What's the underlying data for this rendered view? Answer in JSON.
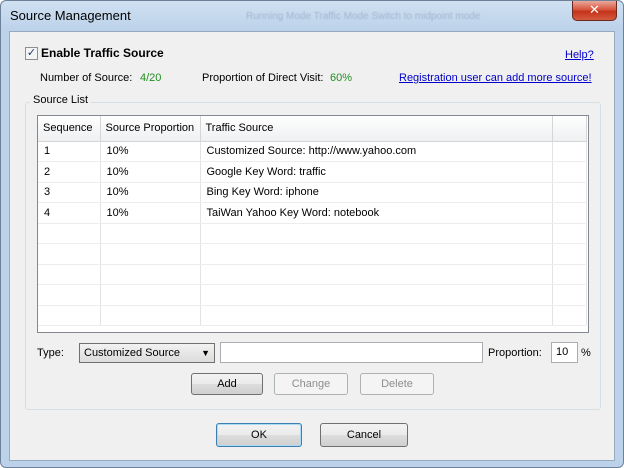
{
  "window": {
    "title": "Source Management",
    "ghost_title": "Running Mode    Traffic Mode    Switch to midpoint mode",
    "close_symbol": "✕"
  },
  "options": {
    "enable_checked_symbol": "✓",
    "enable_label": "Enable Traffic Source",
    "help_label": "Help?"
  },
  "stats": {
    "number_label": "Number of Source:",
    "number_value": "4/20",
    "proportion_label": "Proportion of Direct Visit:",
    "proportion_value": "60%",
    "register_link": "Registration user can add more source!"
  },
  "source_list": {
    "group_label": "Source List",
    "columns": [
      "Sequence",
      "Source Proportion",
      "Traffic Source",
      ""
    ],
    "rows": [
      [
        "1",
        "10%",
        "Customized Source: http://www.yahoo.com"
      ],
      [
        "2",
        "10%",
        "Google Key Word: traffic"
      ],
      [
        "3",
        "10%",
        "Bing Key Word: iphone"
      ],
      [
        "4",
        "10%",
        "TaiWan Yahoo Key Word: notebook"
      ],
      [
        "",
        "",
        ""
      ],
      [
        "",
        "",
        ""
      ],
      [
        "",
        "",
        ""
      ],
      [
        "",
        "",
        ""
      ],
      [
        "",
        "",
        ""
      ]
    ]
  },
  "editor": {
    "type_label": "Type:",
    "type_value": "Customized Source",
    "source_value": "",
    "proportion_label": "Proportion:",
    "proportion_value": "10",
    "percent_sign": "%",
    "add_label": "Add",
    "change_label": "Change",
    "delete_label": "Delete"
  },
  "footer": {
    "ok_label": "OK",
    "cancel_label": "Cancel"
  }
}
